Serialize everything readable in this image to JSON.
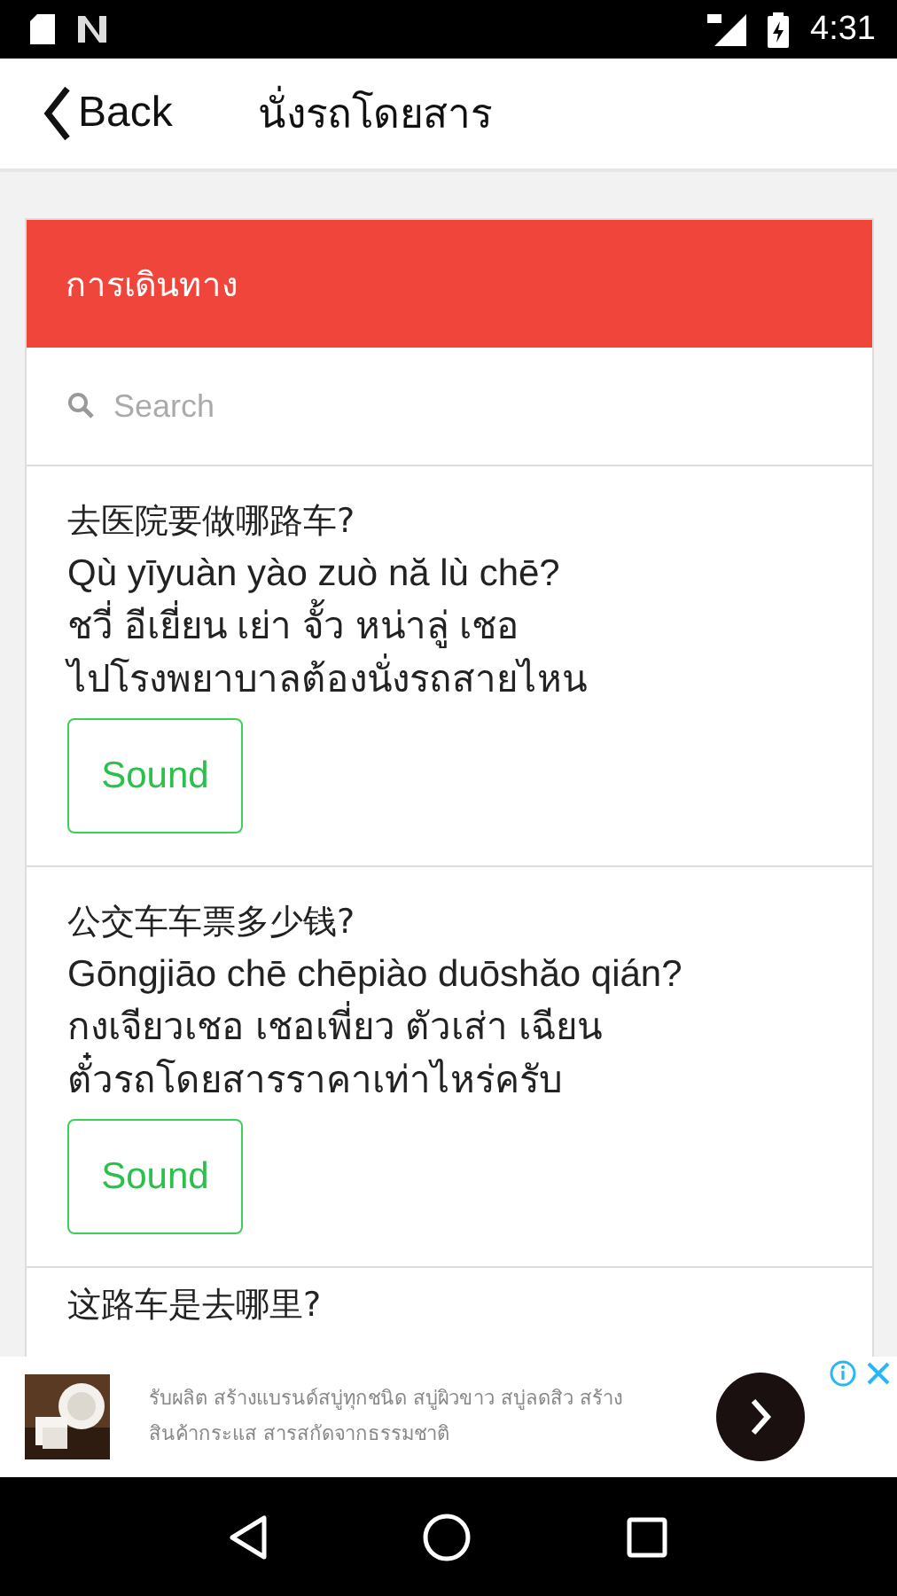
{
  "status_bar": {
    "time": "4:31"
  },
  "header": {
    "back": "Back",
    "title": "นั่งรถโดยสาร"
  },
  "section": {
    "title": "การเดินทาง"
  },
  "search": {
    "placeholder": "Search"
  },
  "phrases": [
    {
      "chinese": "去医院要做哪路车?",
      "pinyin": "Qù yīyuàn yào zuò nă lù chē?",
      "reading": "ชวี่ อีเยี่ยน เย่า จั้ว หน่าลู่ เชอ",
      "meaning": "ไปโรงพยาบาลต้องนั่งรถสายไหน",
      "button": "Sound"
    },
    {
      "chinese": "公交车车票多少钱?",
      "pinyin": "Gōngjiāo chē chēpiào duōshăo qián?",
      "reading": "กงเจียวเชอ เชอเพี่ยว ตัวเส่า เฉียน",
      "meaning": "ตั๋วรถโดยสารราคาเท่าไหร่ครับ",
      "button": "Sound"
    },
    {
      "chinese": "这路车是去哪里?"
    }
  ],
  "ad": {
    "text": "รับผลิต สร้างแบรนด์สบู่ทุกชนิด สบู่ผิวขาว สบู่ลดสิว สร้างสินค้ากระแส สารสกัดจากธรรมชาติ"
  }
}
